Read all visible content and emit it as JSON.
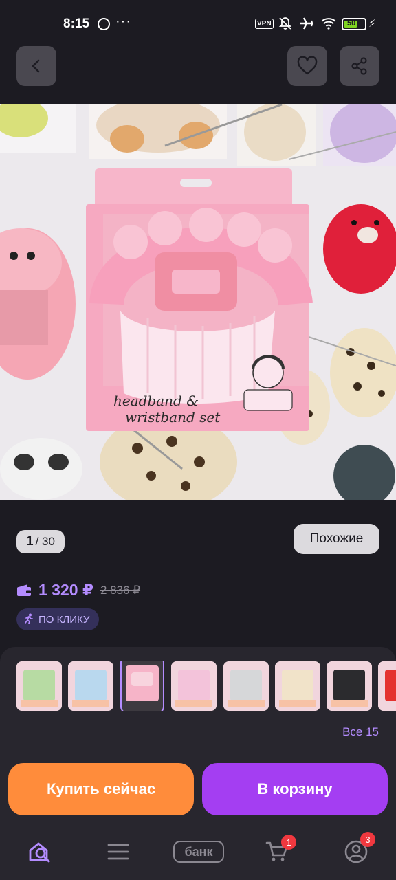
{
  "status_bar": {
    "time": "8:15",
    "vpn": "VPN",
    "battery": "50"
  },
  "header": {
    "back_icon": "chevron-left-icon",
    "favorite_icon": "heart-icon",
    "share_icon": "share-icon"
  },
  "photo": {
    "package_text_line1": "headband &",
    "package_text_line2": "wristband set"
  },
  "gallery": {
    "current": "1",
    "total": "/ 30",
    "similar_label": "Похожие"
  },
  "pricing": {
    "price": "1 320 ₽",
    "old_price": "2 836 ₽",
    "badge": "ПО КЛИКУ",
    "price_color": "#b48cff"
  },
  "variants": {
    "all_label": "Все 15",
    "selected_index": 2
  },
  "actions": {
    "buy_now": "Купить сейчас",
    "add_to_cart": "В корзину",
    "buy_color": "#ff8c3b",
    "cart_color": "#a43ef2"
  },
  "nav": {
    "bank_label": "банк",
    "cart_count": "1",
    "profile_count": "3"
  }
}
